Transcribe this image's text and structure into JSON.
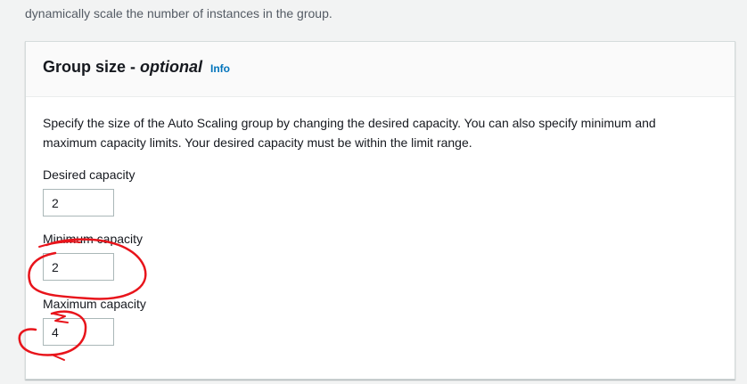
{
  "intro_text": "dynamically scale the number of instances in the group.",
  "panel": {
    "title_main": "Group size - ",
    "title_optional": "optional",
    "info_link": "Info",
    "description": "Specify the size of the Auto Scaling group by changing the desired capacity. You can also specify minimum and maximum capacity limits. Your desired capacity must be within the limit range."
  },
  "fields": {
    "desired": {
      "label": "Desired capacity",
      "value": "2"
    },
    "minimum": {
      "label": "Minimum capacity",
      "value": "2"
    },
    "maximum": {
      "label": "Maximum capacity",
      "value": "4"
    }
  },
  "colors": {
    "annotation": "#e8141b",
    "link": "#0073bb"
  }
}
